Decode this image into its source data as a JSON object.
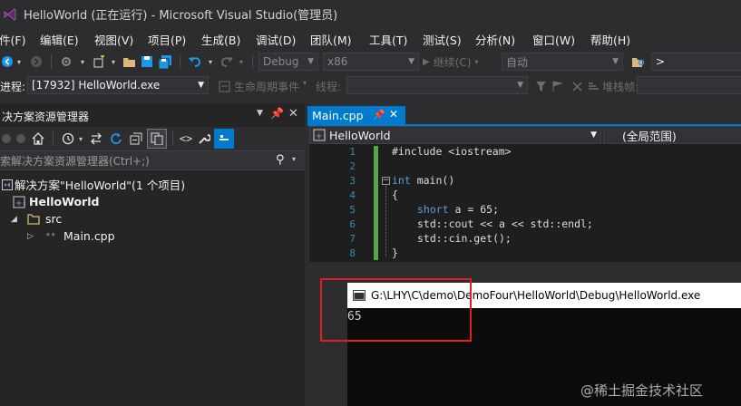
{
  "window": {
    "title": "HelloWorld (正在运行) - Microsoft Visual Studio(管理员)"
  },
  "menu": {
    "items": [
      "件(F)",
      "编辑(E)",
      "视图(V)",
      "项目(P)",
      "生成(B)",
      "调试(D)",
      "团队(M)",
      "工具(T)",
      "测试(S)",
      "分析(N)",
      "窗口(W)",
      "帮助(H)"
    ]
  },
  "toolbar": {
    "config_value": "Debug",
    "platform_value": "x86",
    "continue_label": "继续(C)",
    "auto_value": "自动",
    "search_value": ">"
  },
  "debug_toolbar": {
    "process_label": "进程:",
    "process_value": "[17932] HelloWorld.exe",
    "lifecycle_label": "生命周期事件",
    "thread_label": "线程:",
    "stack_label": "堆栈帧:"
  },
  "solution_explorer": {
    "title": "决方案资源管理器",
    "search_placeholder": "索解决方案资源管理器(Ctrl+;)",
    "tree": {
      "solution": "解决方案\"HelloWorld\"(1 个项目)",
      "project": "HelloWorld",
      "folder": "src",
      "file": "Main.cpp"
    }
  },
  "editor": {
    "tab_label": "Main.cpp",
    "scope_left": "HelloWorld",
    "scope_right": "(全局范围)",
    "line_numbers": [
      "1",
      "2",
      "3",
      "4",
      "5",
      "6",
      "7",
      "8"
    ],
    "code": {
      "l1": "#include <iostream>",
      "l3_kw": "int",
      "l3_rest": " main()",
      "l4": "{",
      "l5_kw": "short",
      "l5_rest": " a = 65;",
      "l6": "std::cout << a << std::endl;",
      "l7": "std::cin.get();",
      "l8": "}"
    }
  },
  "console": {
    "title": "G:\\LHY\\C\\demo\\DemoFour\\HelloWorld\\Debug\\HelloWorld.exe",
    "output": "65"
  },
  "watermark": "@稀土掘金技术社区",
  "colors": {
    "accent": "#007acc",
    "highlight_box": "#e02020",
    "modified_bar": "#57a64a"
  }
}
